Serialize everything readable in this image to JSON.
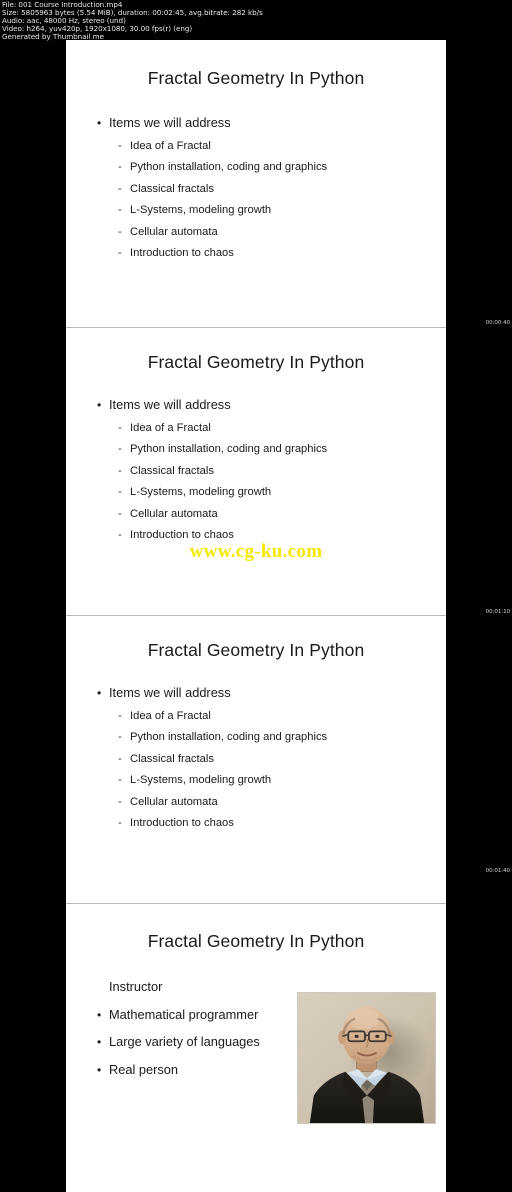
{
  "meta": {
    "lines": [
      "File: 001 Course Introduction.mp4",
      "Size: 5805963 bytes (5.54 MiB), duration: 00:02:45, avg.bitrate: 282 kb/s",
      "Audio: aac, 48000 Hz, stereo (und)",
      "Video: h264, yuv420p, 1920x1080, 30.00 fps(r) (eng)",
      "Generated by Thumbnail me"
    ]
  },
  "slides": [
    {
      "title": "Fractal Geometry In Python",
      "heading": "Items we will address",
      "items": [
        "Idea of a Fractal",
        "Python installation, coding and graphics",
        "Classical fractals",
        "L-Systems, modeling growth",
        "Cellular automata",
        "Introduction to chaos"
      ]
    },
    {
      "title": "Fractal Geometry In Python",
      "heading": "Items we will address",
      "items": [
        "Idea of a Fractal",
        "Python installation, coding and graphics",
        "Classical fractals",
        "L-Systems, modeling growth",
        "Cellular automata",
        "Introduction to chaos"
      ],
      "watermark": "www.cg-ku.com"
    },
    {
      "title": "Fractal Geometry In Python",
      "heading": "Items we will address",
      "items": [
        "Idea of a Fractal",
        "Python installation, coding and graphics",
        "Classical fractals",
        "L-Systems, modeling growth",
        "Cellular automata",
        "Introduction to chaos"
      ]
    },
    {
      "title": "Fractal Geometry In Python",
      "label": "Instructor",
      "items": [
        "Mathematical programmer",
        "Large variety of languages",
        "Real person"
      ]
    }
  ],
  "timestamps": [
    "00:00:40",
    "00:01:10",
    "00:01:40"
  ],
  "glyphs": {
    "bullet": "•",
    "dash": "-"
  },
  "colors": {
    "background": "#000000",
    "slide_background": "#ffffff",
    "text": "#1a1a1a",
    "meta_text": "#e8e8e8",
    "watermark": "#f5e800",
    "timestamp": "#cfcfcf"
  }
}
